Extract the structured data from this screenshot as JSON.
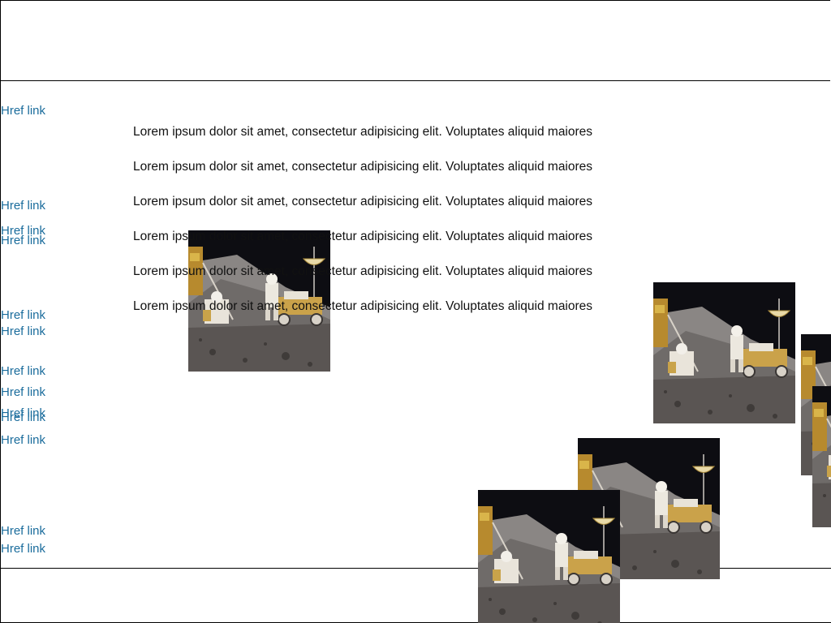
{
  "links": [
    {
      "label": "Href link"
    },
    {
      "label": "Href link"
    },
    {
      "label": "Href link"
    },
    {
      "label": "Href link"
    },
    {
      "label": "Href link"
    },
    {
      "label": "Href link"
    },
    {
      "label": "Href link"
    },
    {
      "label": "Href link"
    },
    {
      "label": "Href link"
    },
    {
      "label": "Href link"
    },
    {
      "label": "Href link"
    },
    {
      "label": "Href link"
    },
    {
      "label": "Href link"
    }
  ],
  "paragraphs": [
    {
      "text": "Lorem ipsum dolor sit amet, consectetur adipisicing elit. Voluptates aliquid maiores"
    },
    {
      "text": "Lorem ipsum dolor sit amet, consectetur adipisicing elit. Voluptates aliquid maiores"
    },
    {
      "text": "Lorem ipsum dolor sit amet, consectetur adipisicing elit. Voluptates aliquid maiores"
    },
    {
      "text": "Lorem ipsum dolor sit amet, consectetur adipisicing elit. Voluptates aliquid maiores"
    },
    {
      "text": "Lorem ipsum dolor sit amet, consectetur adipisicing elit. Voluptates aliquid maiores"
    },
    {
      "text": "Lorem ipsum dolor sit amet, consectetur adipisicing elit. Voluptates aliquid maiores"
    }
  ],
  "images": [
    {
      "subject": "lunar-rover-photo"
    },
    {
      "subject": "lunar-rover-photo"
    },
    {
      "subject": "lunar-rover-photo"
    },
    {
      "subject": "lunar-rover-photo"
    },
    {
      "subject": "lunar-rover-photo"
    },
    {
      "subject": "lunar-rover-photo"
    }
  ],
  "colors": {
    "link": "#1a6c9c",
    "text": "#111111",
    "border": "#000000"
  }
}
